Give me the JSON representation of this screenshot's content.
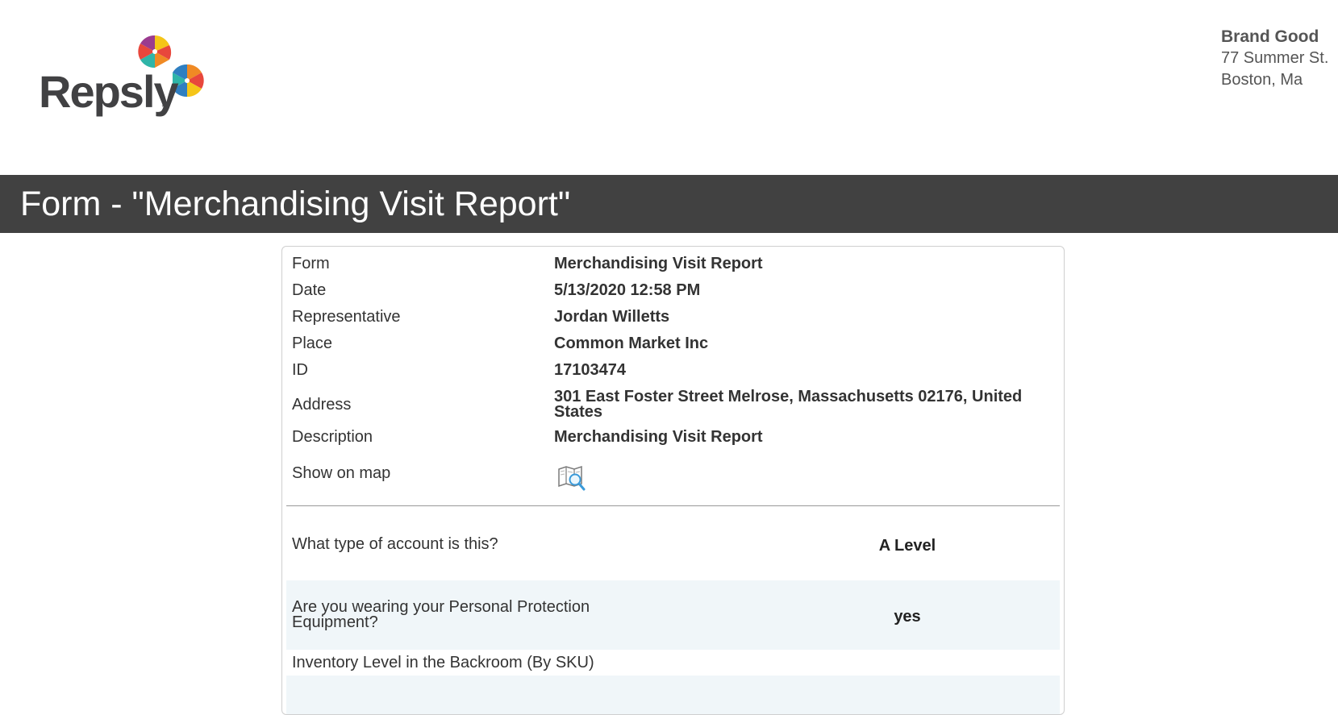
{
  "brand": {
    "logo_text": "Repsly",
    "tm": "™"
  },
  "company": {
    "name": "Brand Good",
    "street": "77 Summer St.",
    "city": "Boston, Ma"
  },
  "title": "Form - \"Merchandising Visit Report\"",
  "details": [
    {
      "label": "Form",
      "value": "Merchandising Visit Report"
    },
    {
      "label": "Date",
      "value": "5/13/2020 12:58 PM"
    },
    {
      "label": "Representative",
      "value": "Jordan Willetts"
    },
    {
      "label": "Place",
      "value": "Common Market Inc"
    },
    {
      "label": "ID",
      "value": "17103474"
    },
    {
      "label": "Address",
      "value": "301 East Foster Street Melrose, Massachusetts 02176, United States"
    },
    {
      "label": "Description",
      "value": "Merchandising Visit Report"
    },
    {
      "label": "Show on map",
      "icon": "map-search-icon"
    }
  ],
  "questions": [
    {
      "question": "What type of account is this?",
      "answer": "A Level"
    },
    {
      "question": "Are you wearing your Personal Protection Equipment?",
      "answer": "yes"
    },
    {
      "question": "Inventory Level in the Backroom (By SKU)",
      "answer": ""
    }
  ],
  "colors": {
    "title_bar": "#414141",
    "shaded_row": "#f0f6f9",
    "text": "#333333"
  }
}
